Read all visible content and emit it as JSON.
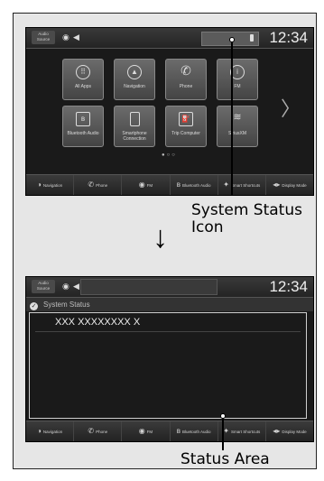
{
  "screen_before": {
    "topbar": {
      "source_label": "Audio Source",
      "clock": "12:34"
    },
    "apps": [
      {
        "label": "All Apps",
        "icon": "grid-icon"
      },
      {
        "label": "Navigation",
        "icon": "compass-icon"
      },
      {
        "label": "Phone",
        "icon": "phone-icon"
      },
      {
        "label": "FM",
        "icon": "radio-icon"
      },
      {
        "label": "Bluetooth Audio",
        "icon": "bluetooth-icon"
      },
      {
        "label": "Smartphone Connection",
        "icon": "smartphone-icon"
      },
      {
        "label": "Trip Computer",
        "icon": "fuel-icon"
      },
      {
        "label": "SiriusXM",
        "icon": "satellite-icon"
      }
    ],
    "bottombar": [
      {
        "label": "Navigation",
        "icon": "compass-icon"
      },
      {
        "label": "Phone",
        "icon": "phone-icon"
      },
      {
        "label": "FM",
        "icon": "radio-icon"
      },
      {
        "label": "Bluetooth Audio",
        "icon": "bluetooth-icon"
      },
      {
        "label": "Smart Shortcuts",
        "icon": "shortcut-icon"
      },
      {
        "label": "Display Mode",
        "icon": "display-icon"
      }
    ]
  },
  "screen_after": {
    "topbar": {
      "source_label": "Audio Source",
      "clock": "12:34"
    },
    "title": "System Status",
    "status_text": "XXX XXXXXXXX X",
    "bottombar": [
      {
        "label": "Navigation",
        "icon": "compass-icon"
      },
      {
        "label": "Phone",
        "icon": "phone-icon"
      },
      {
        "label": "FM",
        "icon": "radio-icon"
      },
      {
        "label": "Bluetooth Audio",
        "icon": "bluetooth-icon"
      },
      {
        "label": "Smart Shortcuts",
        "icon": "shortcut-icon"
      },
      {
        "label": "Display Mode",
        "icon": "display-icon"
      }
    ]
  },
  "callouts": {
    "system_status_icon": "System Status Icon",
    "system_status_icon_line1": "System Status",
    "system_status_icon_line2": "Icon",
    "status_area": "Status Area"
  }
}
